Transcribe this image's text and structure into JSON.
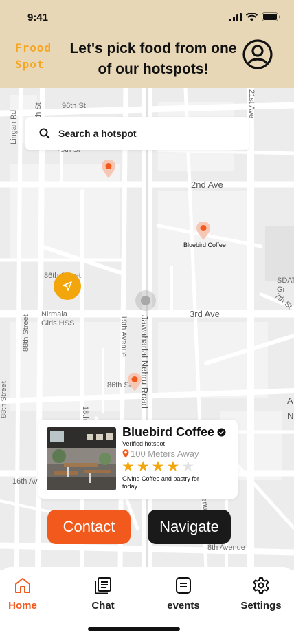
{
  "status_bar": {
    "time": "9:41"
  },
  "header": {
    "logo_line1": "Frood",
    "logo_line2": "Spot",
    "headline": "Let's pick food from one of our hotspots!",
    "profile_icon": "user-circle-icon"
  },
  "search": {
    "placeholder": "Search a hotspot",
    "icon": "search-icon"
  },
  "map": {
    "streets": {
      "s96th": "96th St",
      "s96th_left": "96th St",
      "s75th": "75th St",
      "lingan": "Lingan Rd",
      "ave21st": "21st Ave",
      "ave2nd": "2nd Ave",
      "s86th_mid": "86th Street",
      "nirmala": "Nirmala Girls HSS",
      "s88th": "88th Street",
      "ave19th": "19th Avenue",
      "nehru": "Jawaharlal Nehru Road",
      "ave3rd": "3rd Ave",
      "s86th_low": "86th St",
      "s88th_left": "88th Street",
      "ave16th": "16th Ave",
      "s18th": "18th",
      "ave8th": "8th Avenue",
      "s7th": "7th St",
      "sdat": "SDAT Gr",
      "an": "A N",
      "ave_right": "Avenue"
    },
    "pin_label": "Bluebird Coffee",
    "pin_color": "#f25a1d"
  },
  "card": {
    "name": "Bluebird Coffee",
    "verified": "Verified hotspot",
    "distance": "100 Meters Away",
    "rating": 4,
    "rating_max": 5,
    "description": "Giving Coffee and pastry for today"
  },
  "actions": {
    "contact": "Contact",
    "navigate": "Navigate"
  },
  "tabs": [
    {
      "label": "Home",
      "icon": "home-icon",
      "active": true
    },
    {
      "label": "Chat",
      "icon": "chat-icon",
      "active": false
    },
    {
      "label": "events",
      "icon": "events-icon",
      "active": false
    },
    {
      "label": "Settings",
      "icon": "gear-icon",
      "active": false
    }
  ],
  "colors": {
    "accent": "#f25a1d",
    "header_bg": "#e8d7b6",
    "star": "#f2a60c",
    "logo": "#f5a623"
  }
}
